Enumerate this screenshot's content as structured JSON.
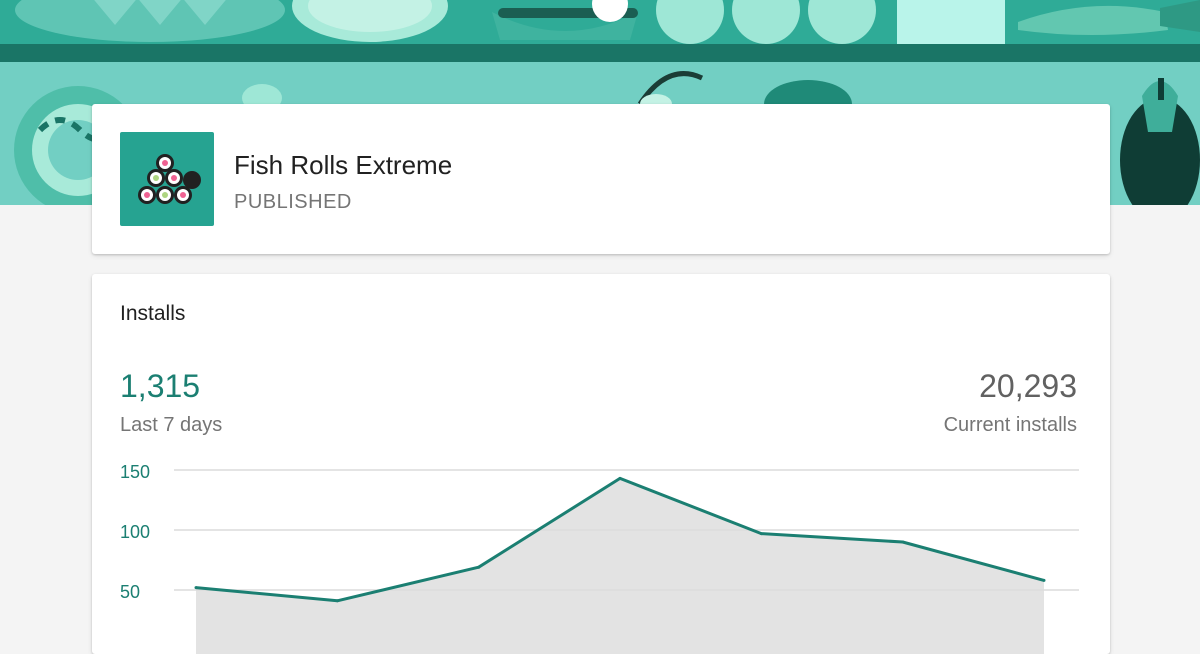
{
  "app": {
    "name": "Fish Rolls Extreme",
    "status": "PUBLISHED",
    "icon": "sushi-rolls-icon"
  },
  "installs_card": {
    "title": "Installs",
    "last7_value": "1,315",
    "last7_label": "Last 7 days",
    "current_value": "20,293",
    "current_label": "Current installs"
  },
  "colors": {
    "accent": "#1b7f72",
    "banner": "#72cfc3",
    "banner_dark": "#1a7566",
    "area_fill": "#e3e3e3",
    "background": "#f4f4f4"
  },
  "chart_data": {
    "type": "area",
    "title": "",
    "xlabel": "",
    "ylabel": "",
    "x": [
      1,
      2,
      3,
      4,
      5,
      6,
      7
    ],
    "series": [
      {
        "values": [
          52,
          41,
          69,
          143,
          97,
          90,
          58
        ]
      }
    ],
    "yticks": [
      "150",
      "100",
      "50"
    ],
    "ytick_values": [
      150,
      100,
      50
    ],
    "ylim": [
      0,
      150
    ],
    "grid": true,
    "legend": "none"
  }
}
